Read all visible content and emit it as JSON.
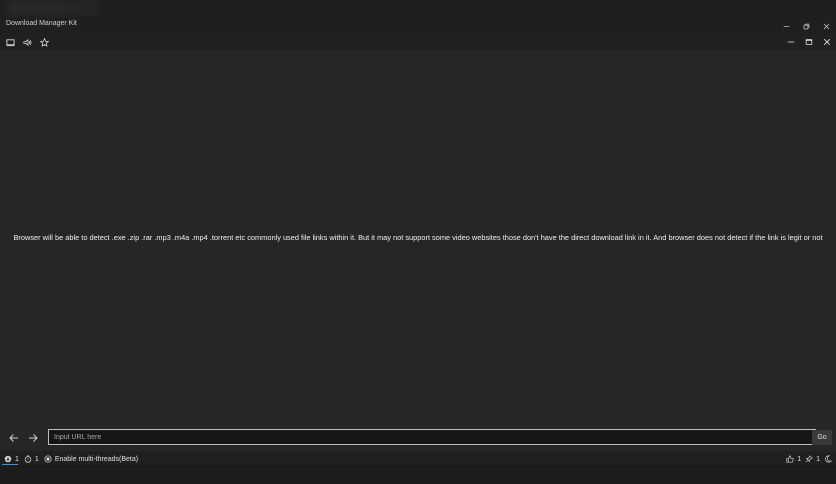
{
  "window": {
    "title": "Download Manager Kit",
    "os_controls": [
      "minimize-icon",
      "restore-icon",
      "close-icon"
    ]
  },
  "toolbar": {
    "icons": [
      "screen-icon",
      "speaker-icon",
      "star-icon"
    ],
    "inner_controls": [
      "minimize-icon",
      "maximize-icon",
      "close-icon"
    ]
  },
  "content": {
    "info": "Browser will be able to detect .exe .zip .rar .mp3 .m4a .mp4 .torrent etc commonly used file links within it. But it may not support some video websites those don't have the direct download link in it. And browser does not detect if the link is legit or not"
  },
  "urlbar": {
    "placeholder": "Input URL here",
    "value": "",
    "go_label": "Go"
  },
  "status": {
    "downloads_count": "1",
    "timer_count": "1",
    "multithread_label": "Enable multi-threads(Beta)",
    "likes_count": "1",
    "pins_count": "1"
  },
  "colors": {
    "background": "#262626",
    "chrome": "#1f1f1f",
    "text": "#f0f0f0",
    "accent": "#4a90d9"
  }
}
